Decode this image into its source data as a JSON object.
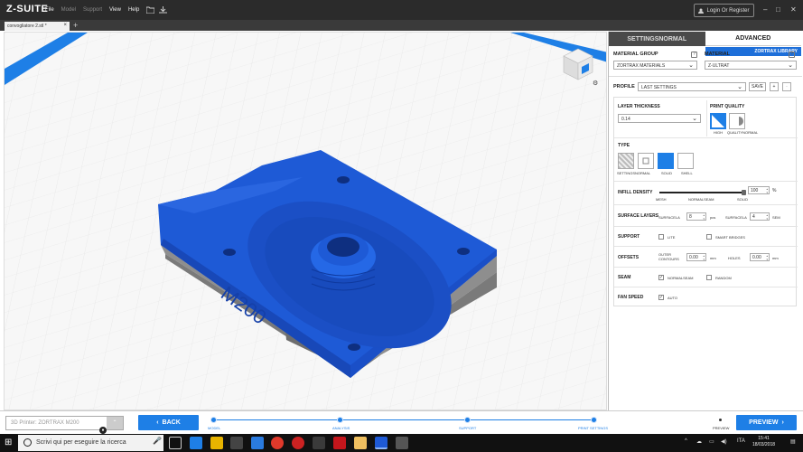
{
  "app": {
    "name": "Z-SUITE",
    "menu": [
      {
        "label": "File",
        "enabled": true
      },
      {
        "label": "Model",
        "enabled": false
      },
      {
        "label": "Support",
        "enabled": false
      },
      {
        "label": "View",
        "enabled": true
      },
      {
        "label": "Help",
        "enabled": true
      }
    ],
    "login_label": "Login Or Register"
  },
  "tabs": {
    "file_tab": "convogliatore 2.stl *",
    "add": "+"
  },
  "viewport": {
    "model_text": "M200",
    "model_color": "#1e5ad6"
  },
  "panel": {
    "tabs": {
      "normal": "SETTINGSNORMAL",
      "advanced": "ADVANCED"
    },
    "library_label": "ZORTRAX LIBRARY",
    "material_group": {
      "label": "MATERIAL GROUP",
      "value": "ZORTRAX MATERIALS"
    },
    "material": {
      "label": "MATERIAL",
      "value": "Z-ULTRAT"
    },
    "profile": {
      "label": "PROFILE",
      "value": "LAST SETTINGS",
      "save_label": "SAVE",
      "add": "+",
      "remove": "-"
    },
    "layer_thickness": {
      "label": "LAYER THICKNESS",
      "value": "0.14"
    },
    "print_quality": {
      "label": "PRINT QUALITY",
      "options": [
        "HIGH",
        "QUALITYNORMAL"
      ]
    },
    "type": {
      "label": "TYPE",
      "options": [
        "SETTINGSNORMAL",
        "SOLID",
        "SHELL"
      ]
    },
    "infill_density": {
      "label": "INFILL DENSITY",
      "value": "100",
      "unit": "%",
      "fill_fraction": 1.0,
      "marks": [
        "MESH",
        "NORMALSEAM",
        "SOLID"
      ]
    },
    "surface_layers": {
      "label": "SURFACE LAYERS",
      "bottom_label": "SURFACELA",
      "bottom_value": "8",
      "bottom_unit": "pcs",
      "top_label": "SURFACELA",
      "top_value": "4",
      "top_unit": "SEM"
    },
    "support": {
      "label": "SUPPORT",
      "options": [
        "LITE",
        "SMART BRIDGES"
      ]
    },
    "offsets": {
      "label": "OFFSETS",
      "outer_label": "OUTER CONTOURS",
      "outer_value": "0.00",
      "outer_unit": "mm",
      "holes_label": "HOLES",
      "holes_value": "0.00",
      "holes_unit": "mm"
    },
    "seam": {
      "label": "SEAM",
      "options": [
        "NORMALSEAM",
        "RANDOM"
      ]
    },
    "fan_speed": {
      "label": "FAN SPEED",
      "option": "AUTO"
    }
  },
  "bottom": {
    "printer": "3D Printer: ZORTRAX M200",
    "back_label": "BACK",
    "steps": [
      "MODEL",
      "ANALYSIS",
      "SUPPORT",
      "PRINT SETTINGS"
    ],
    "preview_step": "PREVIEW",
    "preview_label": "PREVIEW"
  },
  "taskbar": {
    "search_placeholder": "Scrivi qui per eseguire la ricerca",
    "language": "ITA",
    "time": "15:41",
    "date": "18/03/2018"
  },
  "colors": {
    "accent": "#1e7fe6",
    "titlebar": "#2b2b2b",
    "model": "#1e5ad6"
  }
}
